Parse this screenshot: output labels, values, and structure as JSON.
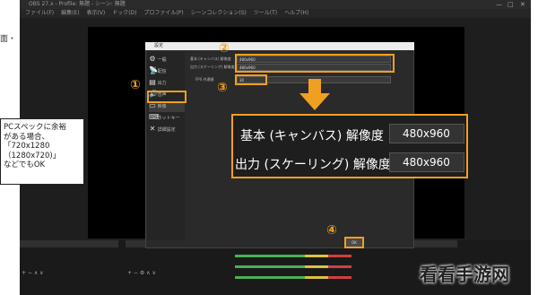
{
  "window": {
    "title": "OBS 27.x - Profile: 無題 - シーン: 無題",
    "controls": [
      "—",
      "□",
      "✕"
    ]
  },
  "menu": [
    "ファイル(F)",
    "編集(E)",
    "表示(V)",
    "ドック(D)",
    "プロファイル(P)",
    "シーンコレクション(S)",
    "ツール(T)",
    "ヘルプ(H)"
  ],
  "left_edge_text": "面・",
  "settings_dialog": {
    "title": "設定",
    "sidebar": [
      "一般",
      "配信",
      "出力",
      "音声",
      "映像",
      "ホットキー",
      "詳細設定"
    ],
    "rows": [
      {
        "label": "基本 (キャンバス) 解像度",
        "value": "480x960"
      },
      {
        "label": "出力 (スケーリング) 解像度",
        "value": "480x960"
      },
      {
        "label": "FPS 共通値",
        "value": "30"
      }
    ],
    "ok_label": "OK"
  },
  "callouts": [
    "①",
    "②",
    "③",
    "④"
  ],
  "zoom_panel": {
    "rows": [
      {
        "label": "基本 (キャンバス) 解像度",
        "value": "480x960"
      },
      {
        "label": "出力 (スケーリング) 解像度",
        "value": "480x960"
      }
    ]
  },
  "note": {
    "lines": [
      "PCスペックに余裕",
      "がある場合、",
      "「720x1280",
      "（1280x720)」",
      "などでもOK"
    ]
  },
  "watermark": "看看手游网",
  "colors": {
    "accent": "#f0a020",
    "obs_bg": "#1e1e1e"
  }
}
